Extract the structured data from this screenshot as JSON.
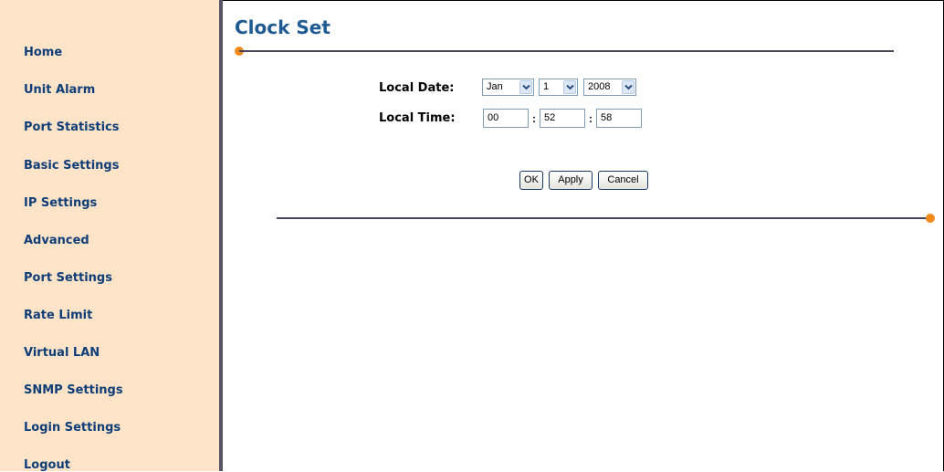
{
  "sidebar": {
    "items": [
      {
        "label": "Home"
      },
      {
        "label": "Unit Alarm"
      },
      {
        "label": "Port Statistics"
      },
      {
        "label": "Basic Settings"
      },
      {
        "label": "IP Settings"
      },
      {
        "label": "Advanced"
      },
      {
        "label": "Port Settings"
      },
      {
        "label": "Rate Limit"
      },
      {
        "label": "Virtual LAN"
      },
      {
        "label": "SNMP Settings"
      },
      {
        "label": "Login Settings"
      },
      {
        "label": "Logout"
      }
    ]
  },
  "page": {
    "title": "Clock Set"
  },
  "form": {
    "date_label": "Local Date:",
    "time_label": "Local Time:",
    "month": "Jan",
    "day": "1",
    "year": "2008",
    "hour": "00",
    "minute": "52",
    "second": "58",
    "separator": ":"
  },
  "buttons": {
    "ok": "OK",
    "apply": "Apply",
    "cancel": "Cancel"
  },
  "colors": {
    "sidebar_bg": "#fde4c8",
    "nav_text": "#0e3d78",
    "title": "#1f5a93",
    "accent_dot": "#f28a1c",
    "rule": "#44445a"
  }
}
